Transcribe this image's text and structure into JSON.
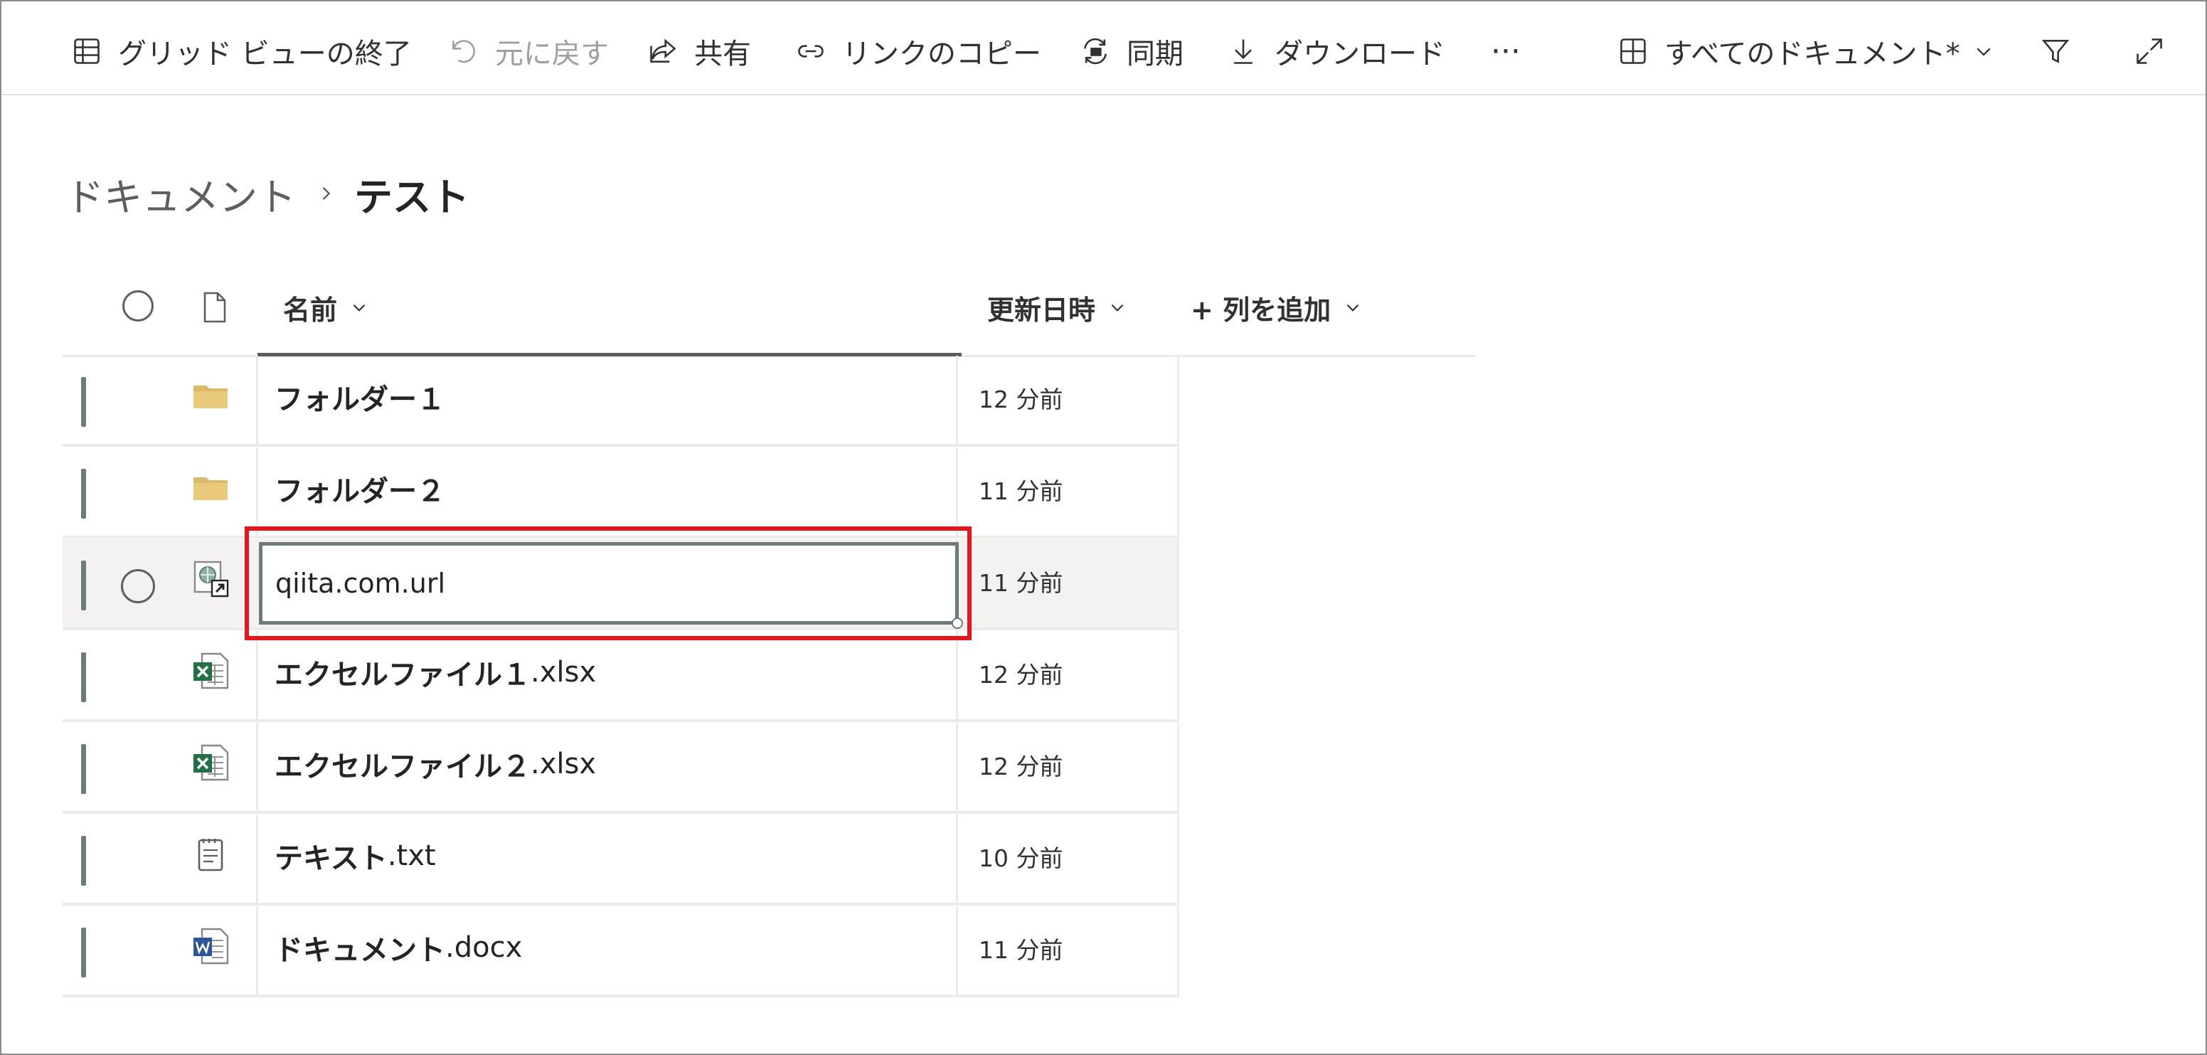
{
  "toolbar": {
    "exit_grid_view": "グリッド ビューの終了",
    "undo": "元に戻す",
    "share": "共有",
    "copy_link": "リンクのコピー",
    "sync": "同期",
    "download": "ダウンロード",
    "more": "···",
    "view_selector": "すべてのドキュメント*"
  },
  "breadcrumb": {
    "root": "ドキュメント",
    "current": "テスト"
  },
  "columns": {
    "name": "名前",
    "modified": "更新日時",
    "add_column": "+ 列を追加"
  },
  "rows": [
    {
      "name": "フォルダー１",
      "ext": "",
      "modified": "12 分前",
      "icon": "folder-icon"
    },
    {
      "name": "フォルダー２",
      "ext": "",
      "modified": "11 分前",
      "icon": "folder-icon"
    },
    {
      "name": "qiita.com.url",
      "ext": "",
      "modified": "11 分前",
      "icon": "url-shortcut-icon",
      "editing": true
    },
    {
      "name": "エクセルファイル１",
      "ext": ".xlsx",
      "modified": "12 分前",
      "icon": "excel-file-icon"
    },
    {
      "name": "エクセルファイル２",
      "ext": ".xlsx",
      "modified": "12 分前",
      "icon": "excel-file-icon"
    },
    {
      "name": "テキスト",
      "ext": ".txt",
      "modified": "10 分前",
      "icon": "text-file-icon"
    },
    {
      "name": "ドキュメント",
      "ext": ".docx",
      "modified": "11 分前",
      "icon": "word-file-icon"
    }
  ],
  "colors": {
    "accent": "#6e7b7c",
    "highlight": "#e8141b",
    "folder": "#dcb967",
    "excel": "#1f7244",
    "word": "#2b579a"
  }
}
